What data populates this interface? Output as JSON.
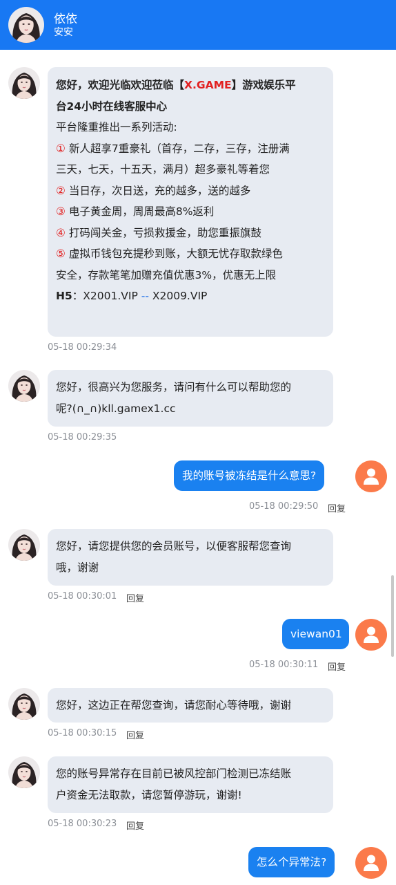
{
  "header": {
    "name": "依依",
    "subtitle": "安安",
    "accent": "#1878f3"
  },
  "welcome": {
    "bold_prefix": "您好，欢迎光临欢迎莅临【",
    "brand": "X.GAME",
    "bold_suffix": "】游戏娱乐平",
    "bold_line2": "台24小时在线客服中心",
    "line3": "平台隆重推出一系列活动:",
    "items": [
      {
        "num": "①",
        "text": "新人超享7重豪礼（首存，二存，三存，注册满"
      },
      {
        "num": "",
        "text": "三天，七天，十五天，满月）超多豪礼等着您"
      },
      {
        "num": "②",
        "text": "当日存，次日送，充的越多，送的越多"
      },
      {
        "num": "③",
        "text": "电子黄金周，周周最高8%返利"
      },
      {
        "num": "④",
        "text": "打码闯关金，亏损救援金，助您重振旗鼓"
      },
      {
        "num": "⑤",
        "text": "虚拟币钱包充提秒到账，大额无忧存取款绿色"
      },
      {
        "num": "",
        "text": "安全，存款笔笔加赠充值优惠3%，优惠无上限"
      }
    ],
    "h5_label": "H5",
    "h5_sep": "：",
    "h5_link1": "X2001.VIP",
    "h5_dash": "--",
    "h5_link2": "X2009.VIP",
    "time": "05-18 00:29:34"
  },
  "messages": [
    {
      "side": "left",
      "lines": [
        "您好，很高兴为您服务，请问有什么可以帮助您的",
        "呢?(∩_∩)kll.gamex1.cc"
      ],
      "time": "05-18 00:29:35",
      "reply": ""
    },
    {
      "side": "right",
      "lines": [
        "我的账号被冻结是什么意思?"
      ],
      "time": "05-18 00:29:50",
      "reply": "回复"
    },
    {
      "side": "left",
      "lines": [
        "您好，请您提供您的会员账号，以便客服帮您查询",
        "哦，谢谢"
      ],
      "time": "05-18 00:30:01",
      "reply": "回复"
    },
    {
      "side": "right",
      "lines": [
        "viewan01"
      ],
      "time": "05-18 00:30:11",
      "reply": "回复"
    },
    {
      "side": "left",
      "lines": [
        "您好，这边正在帮您查询，请您耐心等待哦，谢谢"
      ],
      "time": "05-18 00:30:15",
      "reply": "回复"
    },
    {
      "side": "left",
      "lines": [
        "您的账号异常存在目前已被风控部门检测已冻结账",
        "户资金无法取款，请您暂停游玩，谢谢!"
      ],
      "time": "05-18 00:30:23",
      "reply": "回复"
    },
    {
      "side": "right",
      "lines": [
        "怎么个异常法?"
      ],
      "time": "",
      "reply": ""
    }
  ],
  "icons": {
    "agent_avatar": "agent-avatar-icon",
    "user_avatar": "user-avatar-icon"
  },
  "colors": {
    "user_bubble": "#1a81f0",
    "agent_bubble": "#e7ebf2",
    "user_avatar": "#fb7a4a",
    "highlight_red": "#e22121",
    "link_blue": "#1a6ee8"
  }
}
